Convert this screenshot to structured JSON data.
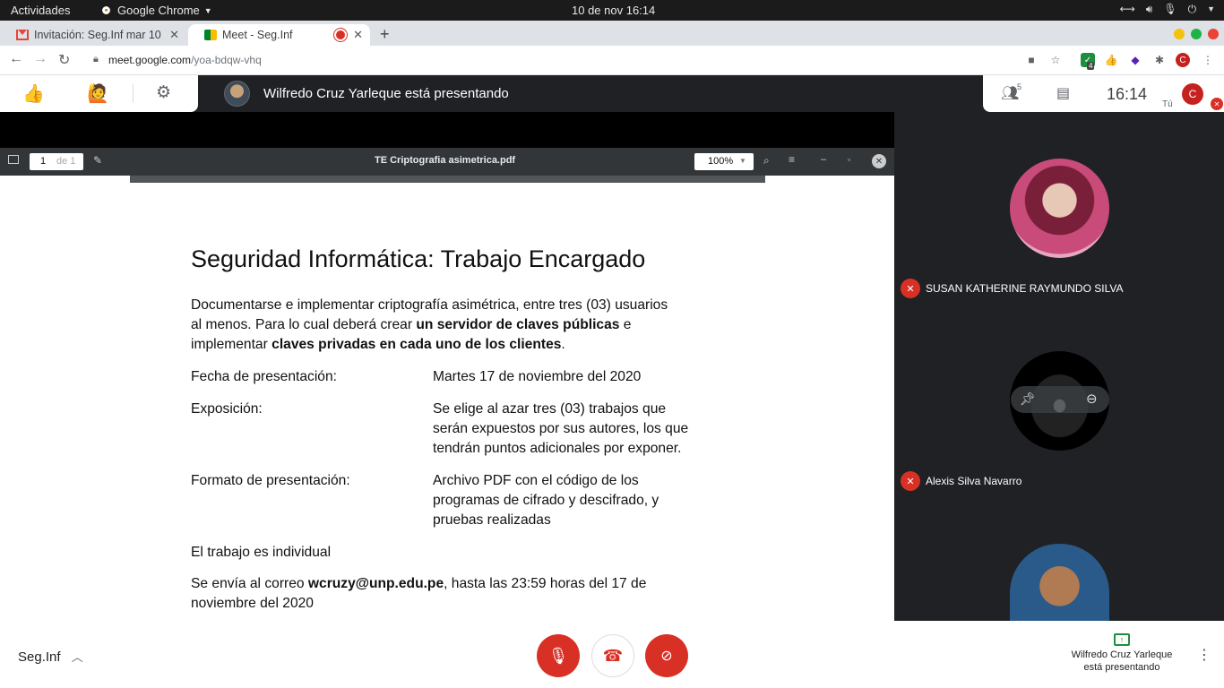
{
  "gnome": {
    "activities": "Actividades",
    "app_name": "Google Chrome",
    "datetime": "10 de nov  16:14"
  },
  "tabs": [
    {
      "title": "Invitación: Seg.Inf mar 10"
    },
    {
      "title": "Meet - Seg.Inf"
    }
  ],
  "address": {
    "host": "meet.google.com",
    "path": "/yoa-bdqw-vhq"
  },
  "extensions": {
    "badge_count": "4",
    "profile_initial": "C"
  },
  "meet": {
    "presenting_banner": "Wilfredo Cruz Yarleque está presentando",
    "people_count": "5",
    "clock": "16:14",
    "self_label": "Tú",
    "self_initial": "C"
  },
  "pdf": {
    "page_current": "1",
    "page_total": "de 1",
    "filename": "TE Criptografia asimetrica.pdf",
    "zoom": "100%"
  },
  "document": {
    "title": "Seguridad Informática: Trabajo Encargado",
    "intro_1": "Documentarse e implementar criptografía asimétrica, entre tres (03) usuarios",
    "intro_2a": "al menos. Para lo cual deberá crear ",
    "intro_2b": "un servidor de claves públicas",
    "intro_2c": " e",
    "intro_3a": "implementar ",
    "intro_3b": "claves privadas en cada uno de los clientes",
    "intro_3c": ".",
    "rows": [
      {
        "label": "Fecha de presentación:",
        "lines": [
          "Martes 17 de noviembre del 2020"
        ]
      },
      {
        "label": "Exposición:",
        "lines": [
          "Se elige al azar tres (03) trabajos que",
          "serán expuestos por sus autores, los que",
          "tendrán puntos adicionales por exponer."
        ]
      },
      {
        "label": "Formato de presentación:",
        "lines": [
          "Archivo PDF con el código de los",
          "programas de cifrado y descifrado, y",
          "pruebas realizadas"
        ]
      }
    ],
    "individual": "El trabajo es individual",
    "send_a": "Se envía al correo ",
    "send_b": "wcruzy@unp.edu.pe",
    "send_c": ", hasta las 23:59 horas del 17 de",
    "send_d": "noviembre del 2020"
  },
  "participants": [
    {
      "name": "SUSAN KATHERINE RAYMUNDO SILVA"
    },
    {
      "name": "Alexis Silva Navarro"
    },
    {
      "name": ""
    }
  ],
  "bottom": {
    "meeting_name": "Seg.Inf",
    "presenting_line1": "Wilfredo Cruz Yarleque",
    "presenting_line2": "está presentando"
  },
  "colors": {
    "danger": "#d93025",
    "meet_bg": "#202124",
    "tab_strip": "#dee1e6"
  }
}
